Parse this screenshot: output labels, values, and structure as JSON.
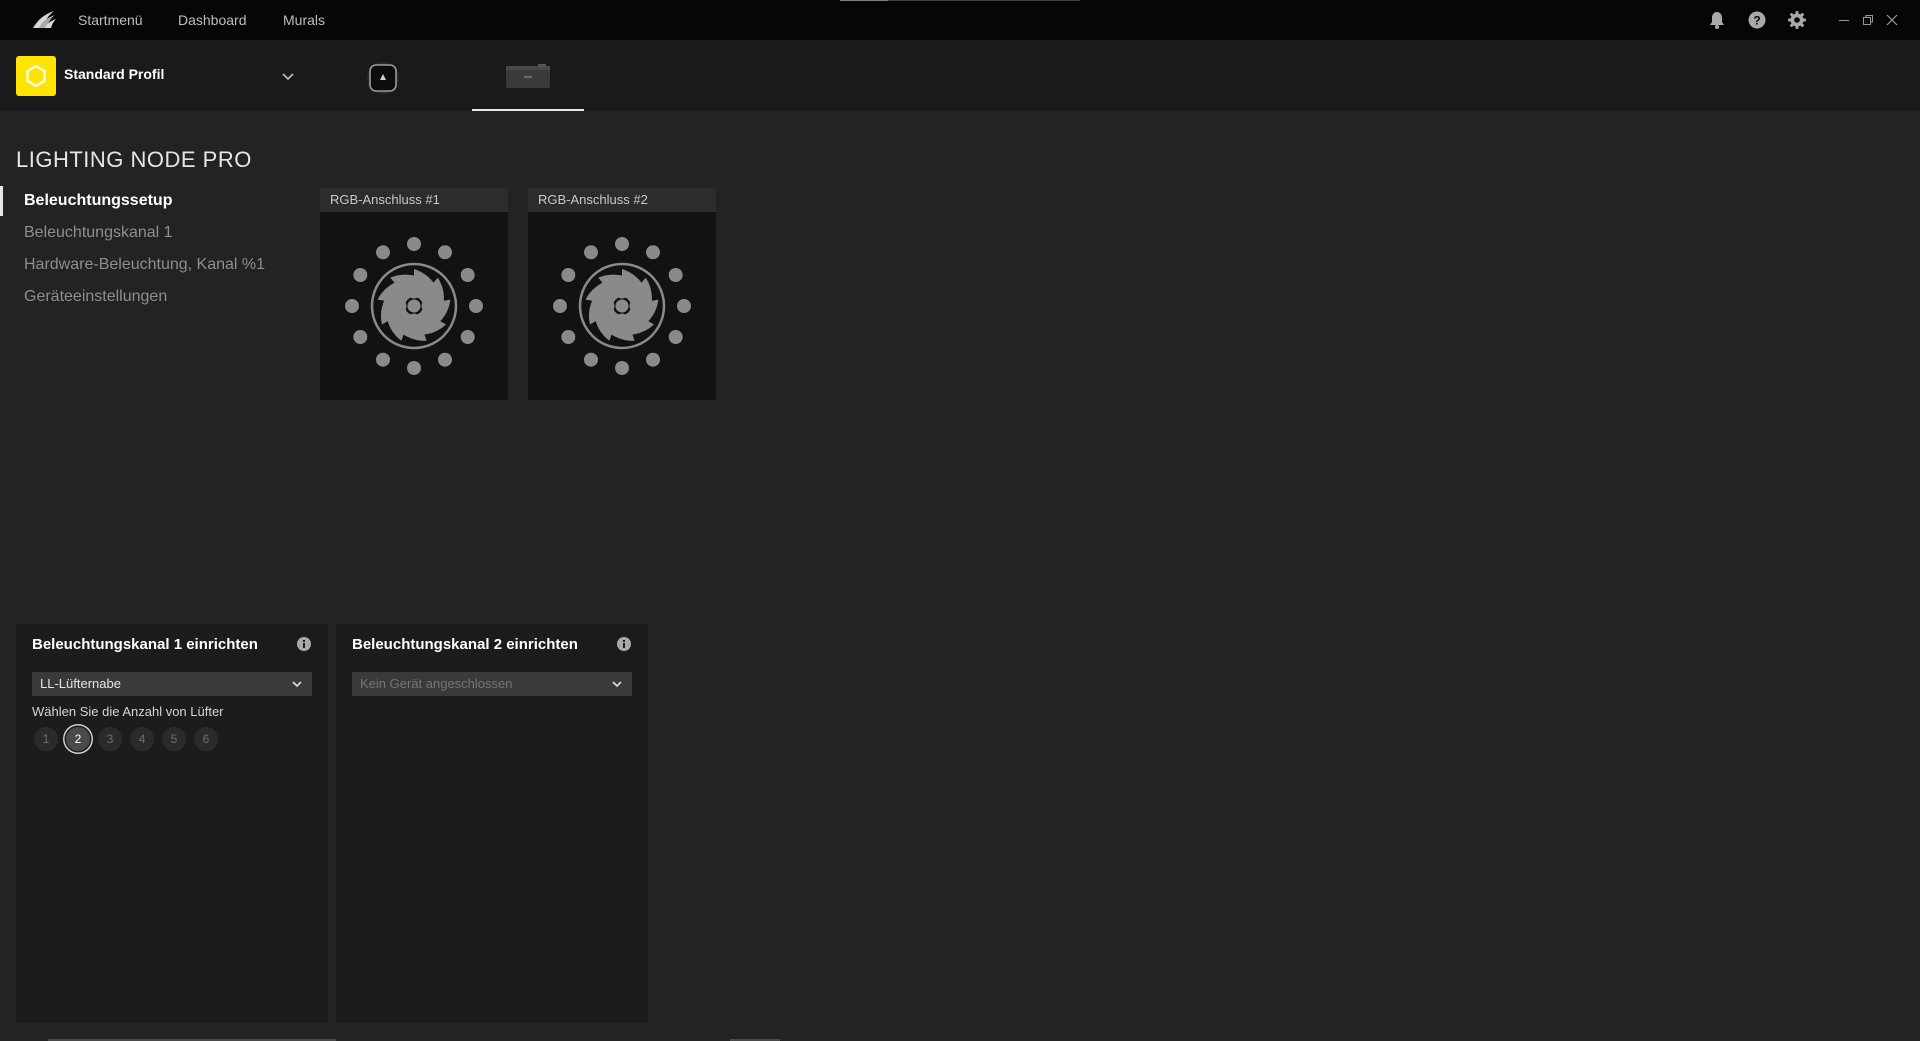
{
  "titlebar": {
    "nav": [
      "Startmenü",
      "Dashboard",
      "Murals"
    ],
    "icons": [
      "bell-icon",
      "help-icon",
      "gear-icon"
    ],
    "window_controls": [
      "minimize-icon",
      "restore-icon",
      "close-icon"
    ]
  },
  "profile": {
    "name": "Standard Profil",
    "accent_color": "#ffe400"
  },
  "devices": [
    {
      "icon": "cooler-device-icon",
      "active": false
    },
    {
      "icon": "lighting-node-device-icon",
      "active": true
    }
  ],
  "page": {
    "title": "LIGHTING NODE PRO"
  },
  "sidebar": {
    "items": [
      {
        "label": "Beleuchtungssetup",
        "active": true
      },
      {
        "label": "Beleuchtungskanal 1",
        "active": false
      },
      {
        "label": "Hardware-Beleuchtung, Kanal %1",
        "active": false
      },
      {
        "label": "Geräteeinstellungen",
        "active": false
      }
    ]
  },
  "ports": [
    {
      "label": "RGB-Anschluss #1"
    },
    {
      "label": "RGB-Anschluss #2"
    }
  ],
  "channels": [
    {
      "title": "Beleuchtungskanal 1 einrichten",
      "dropdown_value": "LL-Lüfternabe",
      "fan_count_label": "Wählen Sie die Anzahl von Lüfter",
      "fan_counts": [
        "1",
        "2",
        "3",
        "4",
        "5",
        "6"
      ],
      "selected_count": "2"
    },
    {
      "title": "Beleuchtungskanal 2 einrichten",
      "dropdown_value": "Kein Gerät angeschlossen",
      "disabled": true
    }
  ]
}
